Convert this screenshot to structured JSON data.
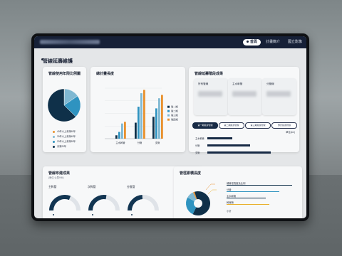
{
  "topbar": {
    "nav": [
      {
        "label": "首頁",
        "active": true
      },
      {
        "label": "計畫簡介"
      },
      {
        "label": "國立影像"
      }
    ]
  },
  "page": {
    "title": "管線延壽維護"
  },
  "pie_card": {
    "title": "管線使用年限比例圖",
    "legend": [
      "40年以上未滿50年",
      "30年以上未滿40年",
      "20年以上未滿30年",
      "未滿20年"
    ],
    "colors": [
      "#e9912e",
      "#7fb8d2",
      "#2f93c0",
      "#0f3049"
    ],
    "chart_data": {
      "type": "pie",
      "categories": [
        "40年以上未滿50年",
        "30年以上未滿40年",
        "20年以上未滿30年",
        "未滿20年"
      ],
      "values": [
        0.4,
        15,
        22,
        62.6
      ]
    }
  },
  "bar_card": {
    "title": "總計畫長度",
    "legend": [
      "第一期",
      "第二期",
      "第三期",
      "第四期"
    ],
    "colors": [
      "#0f3049",
      "#2f93c0",
      "#7fb8d2",
      "#e9912e"
    ],
    "chart_data": {
      "type": "bar",
      "categories": [
        "主水幹管",
        "分管",
        "支管"
      ],
      "series": [
        {
          "name": "第一期",
          "values": [
            4,
            19,
            26
          ]
        },
        {
          "name": "第二期",
          "values": [
            8,
            38,
            36
          ]
        },
        {
          "name": "第三期",
          "values": [
            18,
            54,
            48
          ]
        },
        {
          "name": "第四期",
          "values": [
            20,
            58,
            52
          ]
        }
      ],
      "ylim": [
        0,
        60
      ]
    }
  },
  "stats_card": {
    "title": "管線延壽階段成果",
    "boxes": [
      "所有管線",
      "主水幹管",
      "分管線"
    ],
    "pills": [
      "第一期延壽管線",
      "第二期延壽管線",
      "第三期延壽管線",
      "預計延壽管線"
    ],
    "unit": "單位(km)",
    "chart_data": {
      "type": "bar",
      "categories": [
        "主水幹管",
        "分管",
        "支管"
      ],
      "values": [
        28,
        48,
        71
      ]
    }
  },
  "gauge_card": {
    "title": "管線布建成果",
    "subtitle": "(單位:公里/KM)",
    "gauges": [
      {
        "label": "主幹管",
        "value": 0.62
      },
      {
        "label": "次幹管",
        "value": 0.55
      },
      {
        "label": "分區管",
        "value": 0.48
      }
    ]
  },
  "donut_card": {
    "title": "管徑累積長度",
    "items": [
      "總管徑長度及比例",
      "分管",
      "主水幹管",
      "幹線管"
    ],
    "last_label": "小計",
    "colors": [
      "#0f3049",
      "#2f93c0",
      "#7fb8d2",
      "#e9912e"
    ],
    "chart_data": {
      "type": "pie",
      "categories": [
        "總管徑長度及比例",
        "分管",
        "主水幹管",
        "幹線管"
      ],
      "values": [
        62,
        26,
        10,
        2
      ]
    }
  }
}
